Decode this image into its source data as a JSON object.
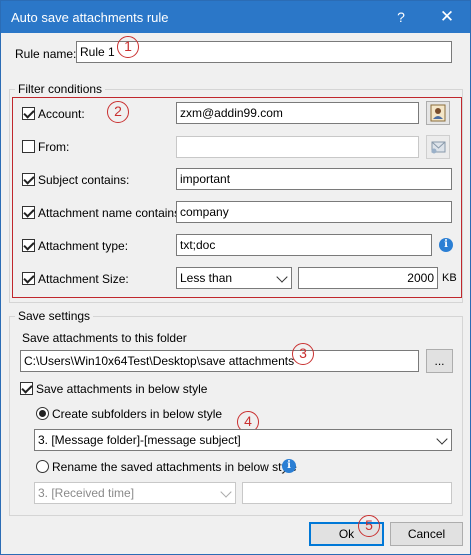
{
  "window": {
    "title": "Auto save attachments rule",
    "help_glyph": "?",
    "close_glyph": "✕"
  },
  "rule": {
    "name_label": "Rule name:",
    "name_value": "Rule 1"
  },
  "filter": {
    "group_title": "Filter conditions",
    "account": {
      "label": "Account:",
      "checked": true,
      "value": "zxm@addin99.com"
    },
    "from": {
      "label": "From:",
      "checked": false,
      "value": ""
    },
    "subject": {
      "label": "Subject contains:",
      "checked": true,
      "value": "important"
    },
    "attachment_name": {
      "label": "Attachment name contains:",
      "checked": true,
      "value": "company"
    },
    "attachment_type": {
      "label": "Attachment type:",
      "checked": true,
      "value": "txt;doc"
    },
    "attachment_size": {
      "label": "Attachment Size:",
      "checked": true,
      "operator": "Less than",
      "value": "2000",
      "unit": "KB"
    }
  },
  "save": {
    "group_title": "Save settings",
    "folder_label": "Save attachments to this folder",
    "folder_path": "C:\\Users\\Win10x64Test\\Desktop\\save attachments",
    "browse_label": "...",
    "style_label": "Save attachments in below style",
    "style_checked": true,
    "subfolders_label": "Create subfolders in below style",
    "subfolders_selected": true,
    "subfolder_style": "3. [Message folder]-[message subject]",
    "rename_label": "Rename the saved attachments in below style",
    "rename_selected": false,
    "rename_style": "3. [Received time]",
    "rename_extra": ""
  },
  "buttons": {
    "ok": "Ok",
    "cancel": "Cancel"
  },
  "callouts": [
    "1",
    "2",
    "3",
    "4",
    "5"
  ],
  "colors": {
    "title_bar": "#2b77c8",
    "highlight_border": "#c0272d",
    "callout": "#c93030",
    "info": "#2b7fd4"
  }
}
